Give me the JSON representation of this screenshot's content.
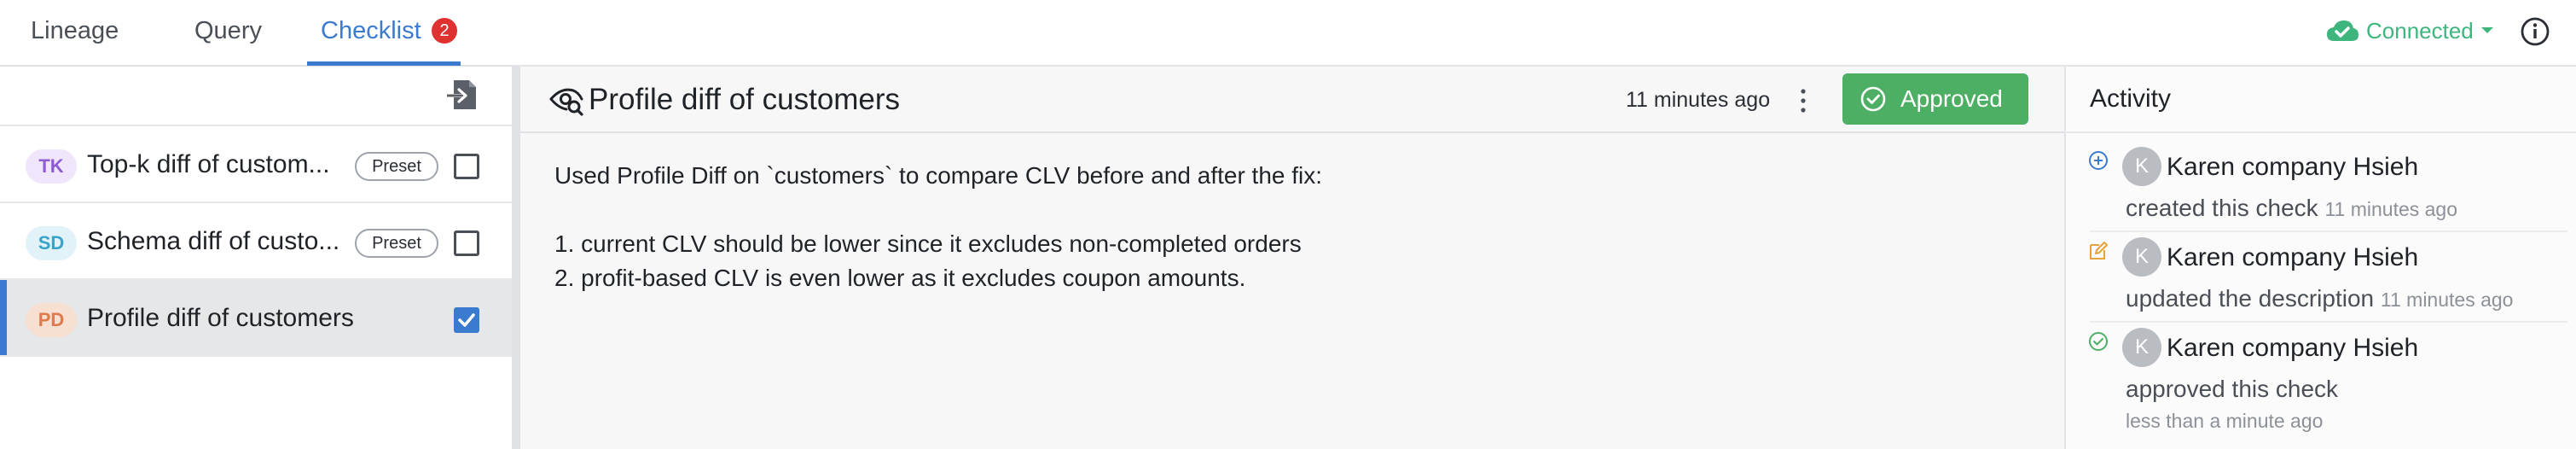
{
  "nav": {
    "tabs": [
      {
        "label": "Lineage"
      },
      {
        "label": "Query"
      },
      {
        "label": "Checklist",
        "badge": "2"
      }
    ],
    "status": {
      "label": "Connected",
      "icon": "cloud-check-icon",
      "color": "#3fb57e"
    },
    "info_icon": "info-icon",
    "accent": "#3a7bd0"
  },
  "checklist": {
    "export_icon": "export-icon",
    "items": [
      {
        "abbr": "TK",
        "label": "Top-k diff of custom...",
        "preset": "Preset",
        "checked": false,
        "badge_color": "#8e5bd6"
      },
      {
        "abbr": "SD",
        "label": "Schema diff of custo...",
        "preset": "Preset",
        "checked": false,
        "badge_color": "#3aa3c9"
      },
      {
        "abbr": "PD",
        "label": "Profile diff of customers",
        "checked": true,
        "badge_color": "#e07a4a"
      }
    ]
  },
  "check": {
    "title": "Profile diff of customers",
    "updated": "11 minutes ago",
    "approve_label": "Approved",
    "approve_color": "#4caf63",
    "description": "Used Profile Diff on `customers` to compare CLV before and after the fix:\n\n1. current CLV should be lower since it excludes non-completed orders\n2. profit-based CLV is even lower as it excludes coupon amounts."
  },
  "activity": {
    "title": "Activity",
    "items": [
      {
        "icon": "plus-circle-icon",
        "avatar": "K",
        "user": "Karen company Hsieh",
        "action": "created this check",
        "time": "11 minutes ago"
      },
      {
        "icon": "edit-icon",
        "avatar": "K",
        "user": "Karen company Hsieh",
        "action": "updated the description",
        "time": "11 minutes ago"
      },
      {
        "icon": "check-circle-icon",
        "avatar": "K",
        "user": "Karen company Hsieh",
        "action": "approved this check",
        "time": "less than a minute ago"
      }
    ]
  }
}
